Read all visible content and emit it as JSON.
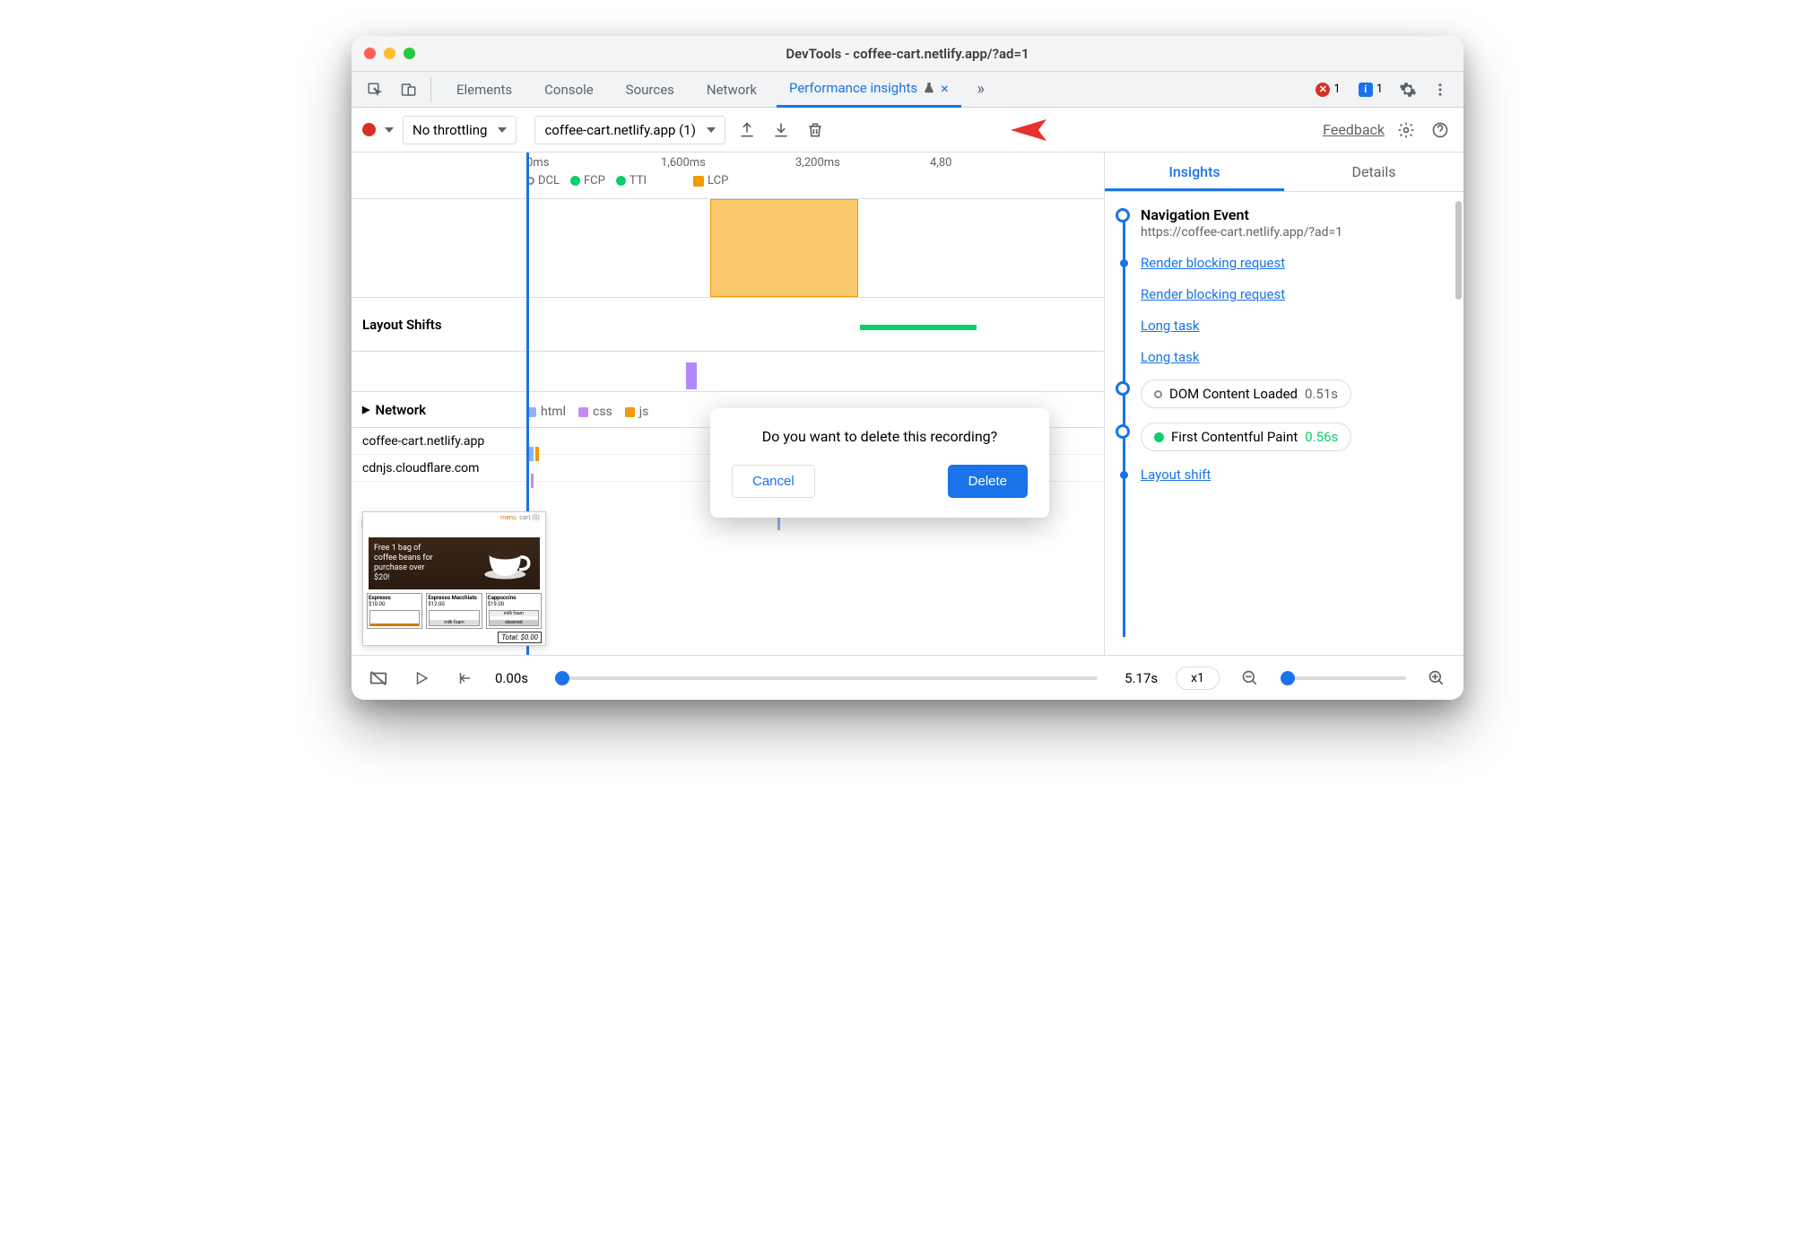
{
  "title": "DevTools - coffee-cart.netlify.app/?ad=1",
  "tabs": {
    "elements": "Elements",
    "console": "Console",
    "sources": "Sources",
    "network": "Network",
    "perf": "Performance insights",
    "error_count": "1",
    "info_count": "1"
  },
  "toolbar": {
    "throttling": "No throttling",
    "recording": "coffee-cart.netlify.app (1)",
    "feedback": "Feedback"
  },
  "timeline": {
    "t0": "0ms",
    "t1": "1,600ms",
    "t2": "3,200ms",
    "t3": "4,80",
    "markers": {
      "dcl": "DCL",
      "fcp": "FCP",
      "tti": "TTI",
      "lcp": "LCP"
    },
    "layout_shifts": "Layout Shifts",
    "network": "Network",
    "legend": {
      "html": "html",
      "css": "css",
      "js": "js"
    },
    "hosts": [
      "coffee-cart.netlify.app",
      "cdnjs.cloudflare.com"
    ]
  },
  "thumb": {
    "banner": "Free 1 bag of coffee beans for purchase over $20!",
    "total": "Total: $0.00",
    "menu": "menu",
    "cart": "cart (0)",
    "products": [
      {
        "name": "Espresso",
        "price": "$10.00"
      },
      {
        "name": "Espresso Macchiato",
        "price": "$12.00"
      },
      {
        "name": "Cappuccino",
        "price": "$19.00"
      }
    ],
    "milk_foam": "milk foam",
    "steamed": "steamed"
  },
  "sidebar": {
    "tab_insights": "Insights",
    "tab_details": "Details",
    "nav_title": "Navigation Event",
    "nav_url": "https://coffee-cart.netlify.app/?ad=1",
    "items": [
      "Render blocking request",
      "Render blocking request",
      "Long task",
      "Long task"
    ],
    "dcl": {
      "label": "DOM Content Loaded",
      "time": "0.51s"
    },
    "fcp": {
      "label": "First Contentful Paint",
      "time": "0.56s"
    },
    "layout_shift": "Layout shift"
  },
  "footer": {
    "start": "0.00s",
    "end": "5.17s",
    "speed": "x1"
  },
  "modal": {
    "text": "Do you want to delete this recording?",
    "cancel": "Cancel",
    "delete": "Delete"
  }
}
